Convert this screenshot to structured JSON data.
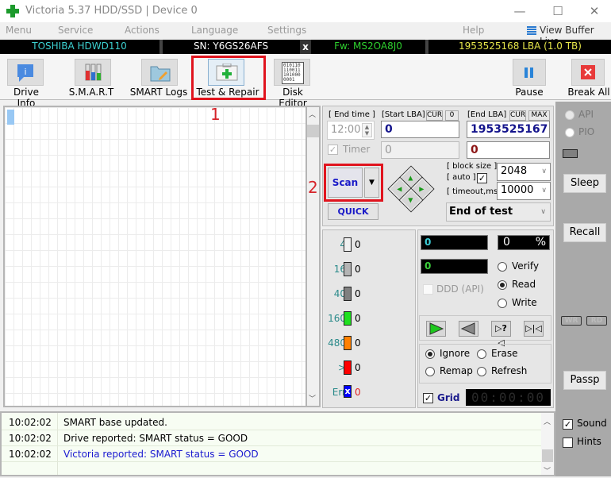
{
  "window": {
    "title": "Victoria 5.37 HDD/SSD | Device 0",
    "minimize": "—",
    "maximize": "☐",
    "close": "✕"
  },
  "menu": {
    "items": [
      "Menu",
      "Service",
      "Actions",
      "Language",
      "Settings",
      "Help"
    ],
    "view_buffer": "View Buffer Live"
  },
  "infobar": {
    "model": "TOSHIBA HDWD110",
    "serial": "SN: Y6GS26AFS",
    "close": "x",
    "firmware": "Fw: MS2OA8J0",
    "capacity": "1953525168 LBA (1.0 TB)"
  },
  "toolbar": {
    "drive_info": "Drive Info",
    "smart": "S.M.A.R.T",
    "smart_logs": "SMART Logs",
    "test_repair": "Test & Repair",
    "disk_editor": "Disk Editor",
    "pause": "Pause",
    "break_all": "Break All",
    "disk_editor_bits": "010110\n110011\n101000\n0001"
  },
  "annotations": {
    "one": "1",
    "two": "2"
  },
  "test": {
    "end_time_label": "[ End time ]",
    "end_time_value": "12:00",
    "timer_label": "Timer",
    "start_lba_label": "[Start LBA]",
    "cur": "CUR",
    "zero_btn": "0",
    "start_lba_value": "0",
    "start_lba_current": "0",
    "end_lba_label": "[End LBA]",
    "max": "MAX",
    "end_lba_value": "1953525167",
    "end_lba_current": "0",
    "scan": "Scan",
    "quick": "QUICK",
    "block_size_label": "[ block size ]",
    "auto_label": "[ auto ]",
    "auto_checked": true,
    "block_size": "2048",
    "timeout_label": "[ timeout,ms ]",
    "timeout": "10000",
    "end_action": "End of test"
  },
  "legend": [
    {
      "label": "4",
      "color": "#f0f0f0",
      "count": "0"
    },
    {
      "label": "16",
      "color": "#b4b4b4",
      "count": "0"
    },
    {
      "label": "40",
      "color": "#808080",
      "count": "0"
    },
    {
      "label": "160",
      "color": "#1fe01f",
      "count": "0"
    },
    {
      "label": "480",
      "color": "#ff8000",
      "count": "0"
    },
    {
      "label": ">",
      "color": "#ff0000",
      "count": "0"
    },
    {
      "label": "Err",
      "color": "#0000ff",
      "count": "0"
    }
  ],
  "stats": {
    "blocks": "0",
    "percent_value": "0",
    "percent_sign": "%",
    "speed": "0",
    "ddd": "DDD (API)",
    "verify": "Verify",
    "read": "Read",
    "write": "Write",
    "selected_mode": "Read"
  },
  "actions": {
    "ignore": "Ignore",
    "erase": "Erase",
    "remap": "Remap",
    "refresh": "Refresh",
    "selected": "Ignore",
    "grid": "Grid",
    "grid_checked": true,
    "timer": "00:00:00"
  },
  "side": {
    "api": "API",
    "pio": "PIO",
    "sleep": "Sleep",
    "recall": "Recall",
    "wr": "WR",
    "rd": "RD",
    "passp": "Passp",
    "sound": "Sound",
    "sound_checked": true,
    "hints": "Hints",
    "hints_checked": false
  },
  "log": [
    {
      "time": "10:02:02",
      "msg": "SMART base updated.",
      "color": "#000000"
    },
    {
      "time": "10:02:02",
      "msg": "Drive reported: SMART status = GOOD",
      "color": "#000000"
    },
    {
      "time": "10:02:02",
      "msg": "Victoria reported: SMART status = GOOD",
      "color": "#1a1ad0"
    }
  ]
}
